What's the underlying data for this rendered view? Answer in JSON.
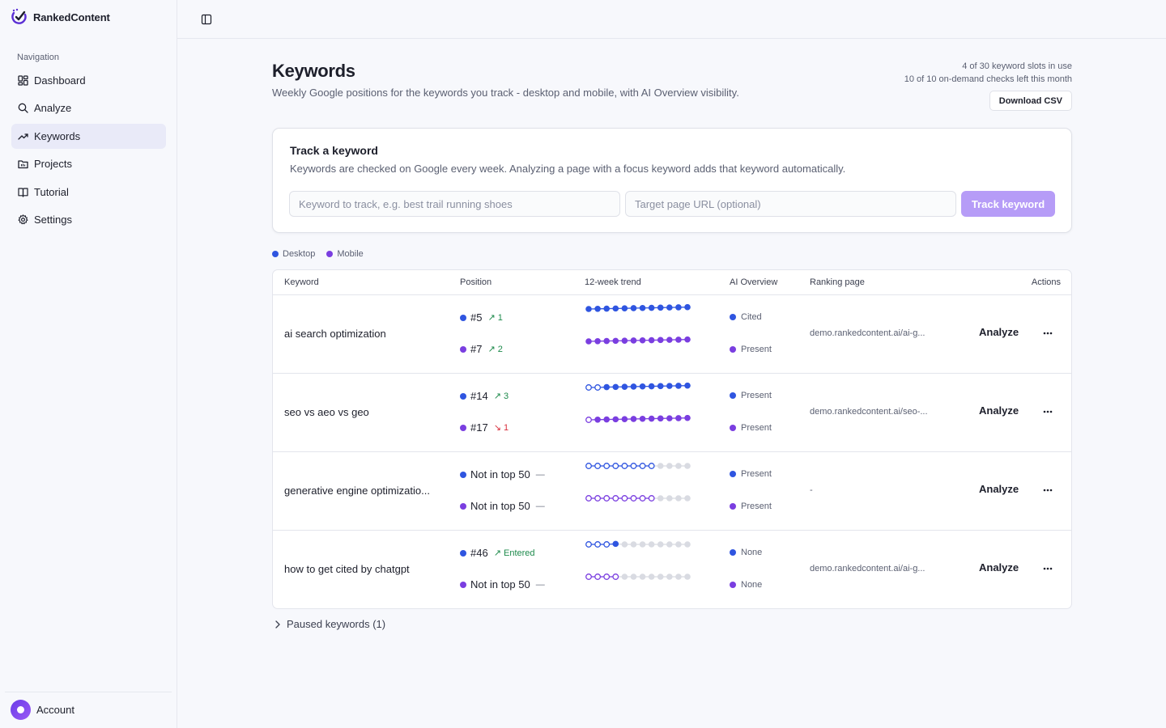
{
  "app": {
    "name": "RankedContent"
  },
  "sidebar": {
    "heading": "Navigation",
    "items": [
      {
        "label": "Dashboard",
        "icon": "dashboard-icon"
      },
      {
        "label": "Analyze",
        "icon": "search-icon"
      },
      {
        "label": "Keywords",
        "icon": "trending-up-icon",
        "active": true
      },
      {
        "label": "Projects",
        "icon": "folder-icon"
      },
      {
        "label": "Tutorial",
        "icon": "book-icon"
      },
      {
        "label": "Settings",
        "icon": "gear-icon"
      }
    ],
    "account_label": "Account"
  },
  "page": {
    "title": "Keywords",
    "subtitle": "Weekly Google positions for the keywords you track - desktop and mobile, with AI Overview visibility.",
    "slots_usage": "4 of 30 keyword slots in use",
    "checks_usage": "10 of 10 on-demand checks left this month",
    "download_label": "Download CSV"
  },
  "track": {
    "title": "Track a keyword",
    "description": "Keywords are checked on Google every week. Analyzing a page with a focus keyword adds that keyword automatically.",
    "keyword_placeholder": "Keyword to track, e.g. best trail running shoes",
    "url_placeholder": "Target page URL (optional)",
    "button_label": "Track keyword"
  },
  "legend": {
    "desktop": "Desktop",
    "mobile": "Mobile"
  },
  "colors": {
    "desktop": "#2f55e0",
    "mobile": "#7a3ee0",
    "empty": "#d9dbe2",
    "accent": "#b69cf7"
  },
  "table": {
    "headers": {
      "keyword": "Keyword",
      "position": "Position",
      "trend": "12-week trend",
      "ai": "AI Overview",
      "page": "Ranking page",
      "actions": "Actions"
    },
    "analyze_label": "Analyze",
    "rows": [
      {
        "keyword": "ai search optimization",
        "desktop": {
          "pos": "#5",
          "arrow": "↗",
          "delta": "1",
          "dir": "up",
          "trend": [
            1,
            1,
            1,
            1,
            1,
            1,
            1,
            1,
            1,
            1,
            1,
            1
          ],
          "ai": "Cited"
        },
        "mobile": {
          "pos": "#7",
          "arrow": "↗",
          "delta": "2",
          "dir": "up",
          "trend": [
            1,
            1,
            1,
            1,
            1,
            1,
            1,
            1,
            1,
            1,
            1,
            1
          ],
          "ai": "Present"
        },
        "page": "demo.rankedcontent.ai/ai-g..."
      },
      {
        "keyword": "seo vs aeo vs geo",
        "desktop": {
          "pos": "#14",
          "arrow": "↗",
          "delta": "3",
          "dir": "up",
          "trend": [
            2,
            2,
            1,
            1,
            1,
            1,
            1,
            1,
            1,
            1,
            1,
            1
          ],
          "ai": "Present"
        },
        "mobile": {
          "pos": "#17",
          "arrow": "↘",
          "delta": "1",
          "dir": "down",
          "trend": [
            2,
            1,
            1,
            1,
            1,
            1,
            1,
            1,
            1,
            1,
            1,
            1
          ],
          "ai": "Present"
        },
        "page": "demo.rankedcontent.ai/seo-..."
      },
      {
        "keyword": "generative engine optimizatio...",
        "desktop": {
          "pos": "Not in top 50",
          "arrow": "",
          "delta": "—",
          "dir": "flat",
          "trend": [
            2,
            2,
            2,
            2,
            2,
            2,
            2,
            2,
            0,
            0,
            0,
            0
          ],
          "ai": "Present"
        },
        "mobile": {
          "pos": "Not in top 50",
          "arrow": "",
          "delta": "—",
          "dir": "flat",
          "trend": [
            2,
            2,
            2,
            2,
            2,
            2,
            2,
            2,
            0,
            0,
            0,
            0
          ],
          "ai": "Present"
        },
        "page": "-"
      },
      {
        "keyword": "how to get cited by chatgpt",
        "desktop": {
          "pos": "#46",
          "arrow": "↗",
          "delta": "Entered",
          "dir": "up",
          "trend": [
            2,
            2,
            2,
            1,
            0,
            0,
            0,
            0,
            0,
            0,
            0,
            0
          ],
          "ai": "None"
        },
        "mobile": {
          "pos": "Not in top 50",
          "arrow": "",
          "delta": "—",
          "dir": "flat",
          "trend": [
            2,
            2,
            2,
            2,
            0,
            0,
            0,
            0,
            0,
            0,
            0,
            0
          ],
          "ai": "None"
        },
        "page": "demo.rankedcontent.ai/ai-g..."
      }
    ]
  },
  "paused": {
    "label": "Paused keywords (1)"
  }
}
